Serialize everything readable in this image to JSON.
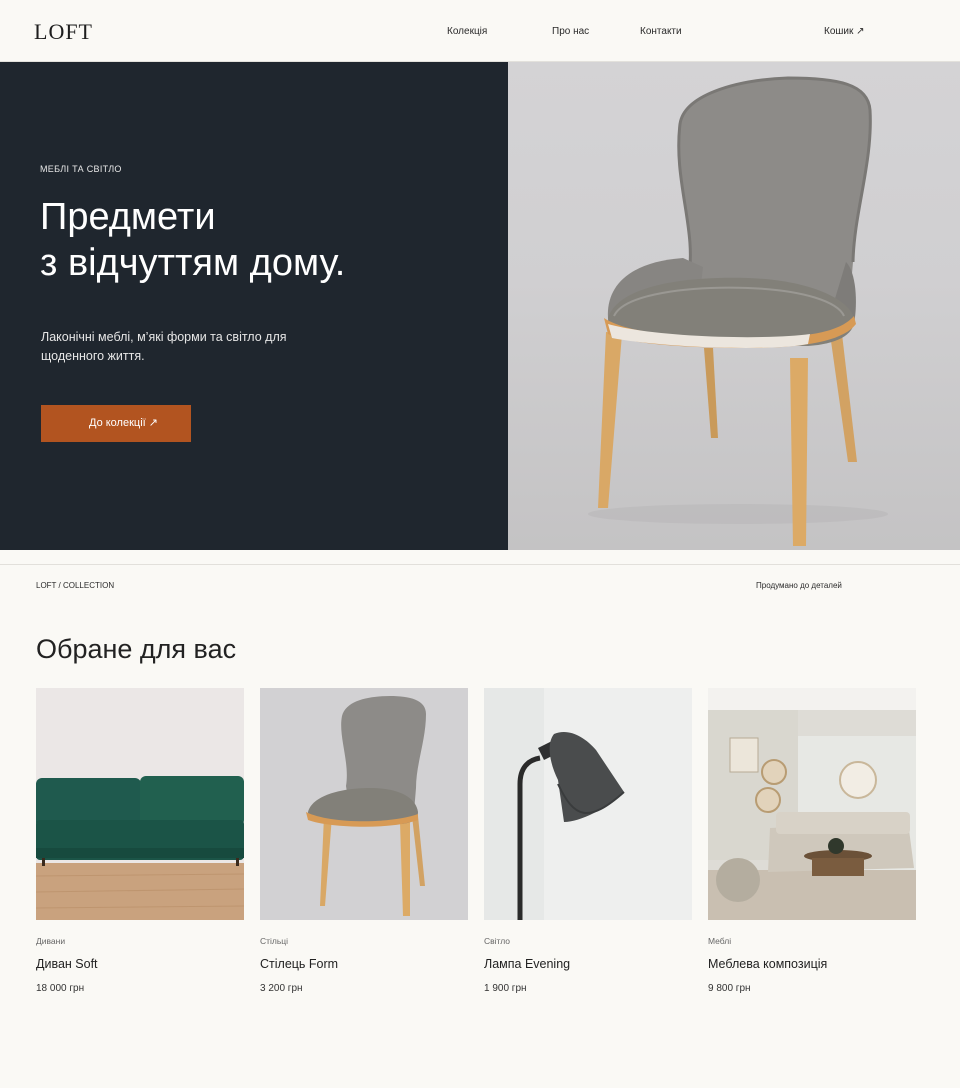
{
  "header": {
    "logo": "LOFT",
    "nav": [
      "Колекція",
      "Про нас",
      "Контакти"
    ],
    "cart": "Кошик ↗"
  },
  "hero": {
    "eyebrow": "МЕБЛІ ТА СВІТЛО",
    "headline_line1": "Предмети",
    "headline_line2": "з відчуттям дому.",
    "subtext": "Лаконічні меблі, м’які форми та світло для щоденного життя.",
    "cta": "До колекції ↗",
    "colors": {
      "panel": "#1f262e",
      "cta": "#b25420"
    }
  },
  "strip": {
    "breadcrumb": "LOFT / COLLECTION",
    "tagline": "Продумано до деталей"
  },
  "featured": {
    "title": "Обране для вас",
    "products": [
      {
        "category": "Дивани",
        "name": "Диван Soft",
        "price": "18 000 грн",
        "image": "green-sofa-photo"
      },
      {
        "category": "Стільці",
        "name": "Стілець Form",
        "price": "3 200 грн",
        "image": "grey-chair-photo"
      },
      {
        "category": "Світло",
        "name": "Лампа Evening",
        "price": "1 900 грн",
        "image": "floor-lamp-photo"
      },
      {
        "category": "Меблі",
        "name": "Меблева композиція",
        "price": "9 800 грн",
        "image": "living-room-photo"
      }
    ]
  }
}
